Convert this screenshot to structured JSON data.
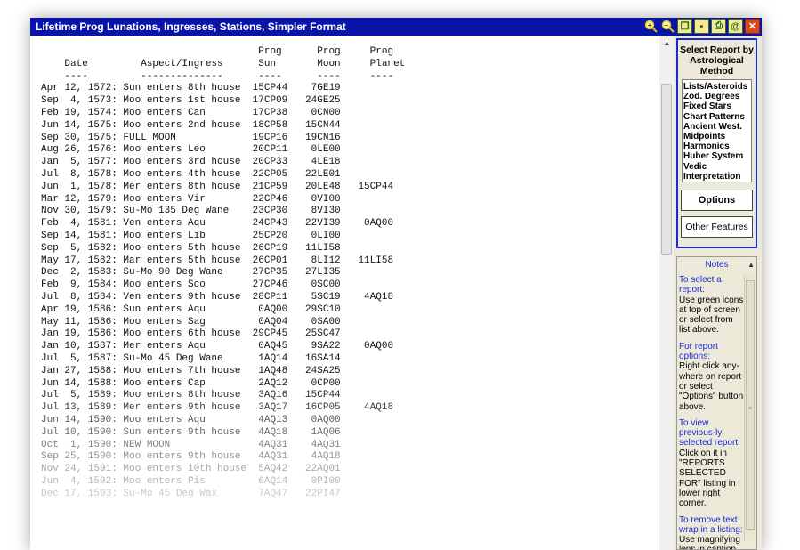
{
  "window": {
    "title": "Lifetime Prog Lunations, Ingresses, Stations, Simpler Format",
    "buttons": {
      "zoom_in": "+",
      "zoom_out": "−",
      "restore": "❐",
      "save": "▪",
      "print": "⎙",
      "email": "@",
      "close": "✕"
    }
  },
  "report": {
    "lines": [
      "                                     Prog      Prog     Prog",
      "    Date         Aspect/Ingress      Sun       Moon     Planet",
      "    ----         --------------      ----      ----     ----",
      "Apr 12, 1572: Sun enters 8th house  15CP44    7GE19",
      "Sep  4, 1573: Moo enters 1st house  17CP09   24GE25",
      "Feb 19, 1574: Moo enters Can        17CP38    0CN00",
      "Jun 14, 1575: Moo enters 2nd house  18CP58   15CN44",
      "Sep 30, 1575: FULL MOON             19CP16   19CN16",
      "Aug 26, 1576: Moo enters Leo        20CP11    0LE00",
      "Jan  5, 1577: Moo enters 3rd house  20CP33    4LE18",
      "Jul  8, 1578: Moo enters 4th house  22CP05   22LE01",
      "Jun  1, 1578: Mer enters 8th house  21CP59   20LE48   15CP44",
      "Mar 12, 1579: Moo enters Vir        22CP46    0VI00",
      "Nov 30, 1579: Su-Mo 135 Deg Wane    23CP30    8VI30",
      "Feb  4, 1581: Ven enters Aqu        24CP43   22VI39    0AQ00",
      "Sep 14, 1581: Moo enters Lib        25CP20    0LI00",
      "Sep  5, 1582: Moo enters 5th house  26CP19   11LI58",
      "May 17, 1582: Mar enters 5th house  26CP01    8LI12   11LI58",
      "Dec  2, 1583: Su-Mo 90 Deg Wane     27CP35   27LI35",
      "Feb  9, 1584: Moo enters Sco        27CP46    0SC00",
      "Jul  8, 1584: Ven enters 9th house  28CP11    5SC19    4AQ18",
      "Apr 19, 1586: Sun enters Aqu         0AQ00   29SC10",
      "May 11, 1586: Moo enters Sag         0AQ04    0SA00",
      "Jan 19, 1586: Moo enters 6th house  29CP45   25SC47",
      "Jan 10, 1587: Mer enters Aqu         0AQ45    9SA22    0AQ00",
      "Jul  5, 1587: Su-Mo 45 Deg Wane      1AQ14   16SA14",
      "Jan 27, 1588: Moo enters 7th house   1AQ48   24SA25",
      "Jun 14, 1588: Moo enters Cap         2AQ12    0CP00",
      "Jul  5, 1589: Moo enters 8th house   3AQ16   15CP44",
      "Jul 13, 1589: Mer enters 9th house   3AQ17   16CP05    4AQ18",
      "Jun 14, 1590: Moo enters Aqu         4AQ13    0AQ00",
      "Jul 10, 1590: Sun enters 9th house   4AQ18    1AQ06",
      "Oct  1, 1590: NEW MOON               4AQ31    4AQ31",
      "Sep 25, 1590: Moo enters 9th house   4AQ31    4AQ18",
      "Nov 24, 1591: Moo enters 10th house  5AQ42   22AQ01",
      "Jun  4, 1592: Moo enters Pis         6AQ14    0PI00",
      "Dec 17, 1593: Su-Mo 45 Deg Wax       7AQ47   22PI47"
    ]
  },
  "sidebar": {
    "title": "Select Report by Astrological Method",
    "methods": [
      "Lists/Asteroids",
      "Zod. Degrees",
      "Fixed Stars",
      "Chart Patterns",
      "Ancient West.",
      "Midpoints",
      "Harmonics",
      "Huber System",
      "Vedic",
      "Interpretation"
    ],
    "options_label": "Options",
    "other_features_label": "Other Features"
  },
  "notes": {
    "title": "Notes",
    "items": [
      {
        "heading": "To select a report:",
        "text": "Use green icons at top of screen or select from list above."
      },
      {
        "heading": "For report options:",
        "text": "Right click any-where on report or select \"Options\" button above."
      },
      {
        "heading": "To view previous-ly selected report:",
        "text": "Click on it in \"REPORTS SELECTED FOR\" listing in lower right corner."
      },
      {
        "heading": "To remove text wrap in a listing:",
        "text": "Use magnifying lens in caption area above report."
      }
    ]
  },
  "colors": {
    "titlebar": "#0a14a8",
    "accent_blue": "#1a2ad8",
    "panel_bg": "#ece9d8",
    "close_button": "#d6451b"
  }
}
